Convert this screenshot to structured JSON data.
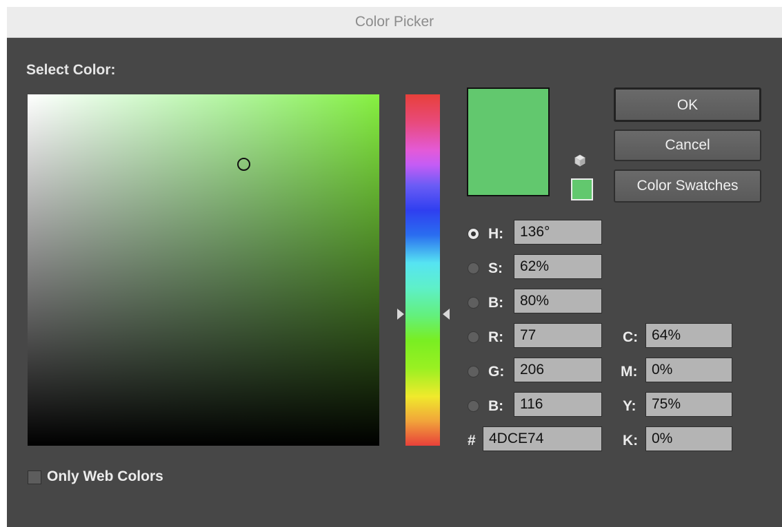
{
  "window": {
    "title": "Color Picker"
  },
  "select_label": "Select Color:",
  "current_color_hex": "#4DCE74",
  "buttons": {
    "ok": "OK",
    "cancel": "Cancel",
    "swatches": "Color Swatches"
  },
  "fields": {
    "h": {
      "label": "H:",
      "value": "136°",
      "selected": true
    },
    "s": {
      "label": "S:",
      "value": "62%",
      "selected": false
    },
    "b": {
      "label": "B:",
      "value": "80%",
      "selected": false
    },
    "r": {
      "label": "R:",
      "value": "77",
      "selected": false
    },
    "g": {
      "label": "G:",
      "value": "206",
      "selected": false
    },
    "bl": {
      "label": "B:",
      "value": "116",
      "selected": false
    },
    "hex": {
      "label": "#",
      "value": "4DCE74"
    },
    "c": {
      "label": "C:",
      "value": "64%"
    },
    "m": {
      "label": "M:",
      "value": "0%"
    },
    "y": {
      "label": "Y:",
      "value": "75%"
    },
    "k": {
      "label": "K:",
      "value": "0%"
    }
  },
  "web_colors": {
    "label": "Only Web Colors",
    "checked": false
  },
  "icons": {
    "gamut": "cube-icon"
  }
}
